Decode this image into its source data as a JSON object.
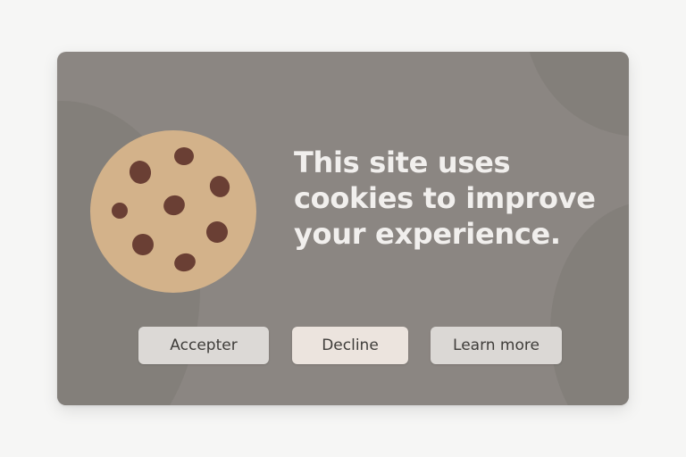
{
  "banner": {
    "message": "This site uses cookies to improve your experience.",
    "cookie_icon": "cookie-icon",
    "buttons": {
      "accept_label": "Accepter",
      "decline_label": "Decline",
      "learn_more_label": "Learn more"
    }
  },
  "colors": {
    "page_background": "#f6f6f5",
    "banner_background": "#8b8682",
    "text": "#f1efed",
    "cookie_dough": "#d3b28a",
    "cookie_chips": "#6a3f34",
    "accept_button": "#dcd9d6",
    "decline_button": "#ece4de",
    "learn_more_button": "#dbd8d5"
  }
}
